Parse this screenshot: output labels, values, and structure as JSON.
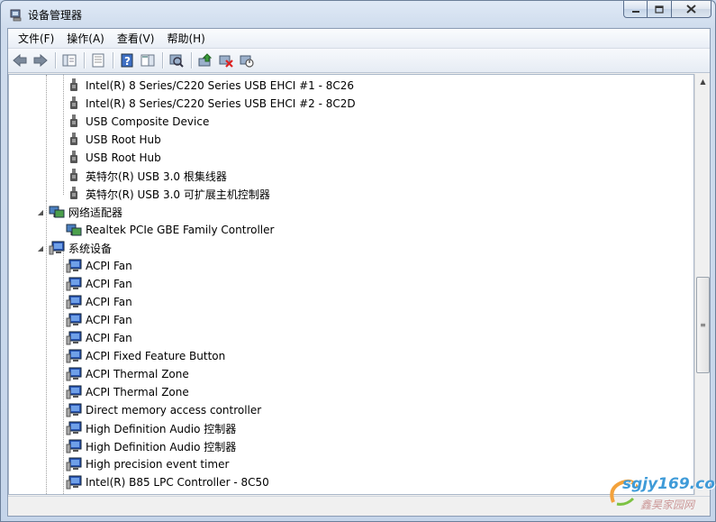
{
  "window": {
    "title": "设备管理器"
  },
  "menu": [
    "文件(F)",
    "操作(A)",
    "查看(V)",
    "帮助(H)"
  ],
  "toolbar_icons": [
    "back-icon",
    "forward-icon",
    "show-hide-tree-icon",
    "properties-icon",
    "help-icon",
    "action-pane-icon",
    "scan-hardware-icon",
    "update-driver-icon",
    "uninstall-icon",
    "disable-icon"
  ],
  "tree": {
    "usb_devices": [
      "Intel(R) 8 Series/C220 Series  USB EHCI #1 - 8C26",
      "Intel(R) 8 Series/C220 Series  USB EHCI #2 - 8C2D",
      "USB Composite Device",
      "USB Root Hub",
      "USB Root Hub",
      "英特尔(R) USB 3.0 根集线器",
      "英特尔(R) USB 3.0 可扩展主机控制器"
    ],
    "network_category": "网络适配器",
    "network_devices": [
      "Realtek PCIe GBE Family Controller"
    ],
    "system_category": "系统设备",
    "system_devices": [
      "ACPI Fan",
      "ACPI Fan",
      "ACPI Fan",
      "ACPI Fan",
      "ACPI Fan",
      "ACPI Fixed Feature Button",
      "ACPI Thermal Zone",
      "ACPI Thermal Zone",
      "Direct memory access controller",
      "High Definition Audio 控制器",
      "High Definition Audio 控制器",
      "High precision event timer",
      "Intel(R)  B85 LPC Controller - 8C50"
    ]
  },
  "watermark": {
    "text": "sgjy169.com",
    "sub": "鑫昊家园网"
  }
}
